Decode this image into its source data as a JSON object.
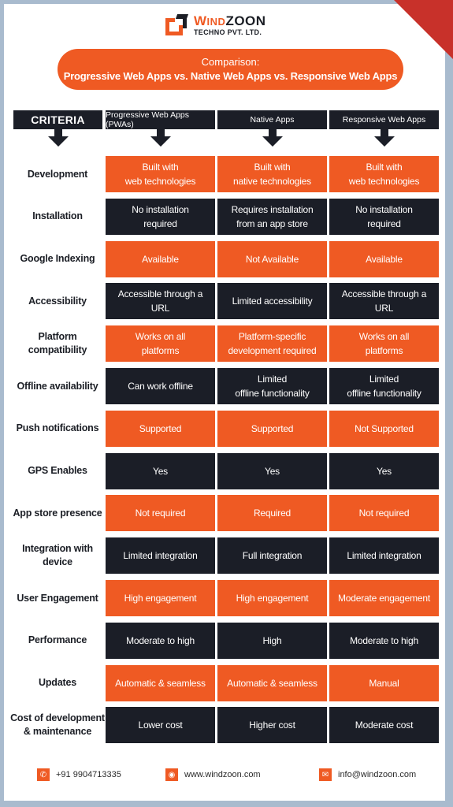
{
  "brand": {
    "name_first": "W",
    "name_ind": "IND",
    "name_rest": "ZOON",
    "subtitle": "TECHNO PVT. LTD."
  },
  "title": {
    "line1": "Comparison:",
    "line2": "Progressive Web Apps vs. Native Web Apps vs. Responsive Web Apps"
  },
  "colors": {
    "accent": "#ef5a23",
    "dark": "#1b1e27",
    "corner": "#c8312a",
    "frame": "#a9bbce"
  },
  "table": {
    "headers": [
      "CRITERIA",
      "Progressive Web Apps (PWAs)",
      "Native Apps",
      "Responsive Web Apps"
    ],
    "rows": [
      {
        "criteria": "Development",
        "style": "orange",
        "values": [
          "Built with\nweb technologies",
          "Built with\nnative technologies",
          "Built with\nweb technologies"
        ]
      },
      {
        "criteria": "Installation",
        "style": "dark",
        "values": [
          "No installation\nrequired",
          "Requires installation\nfrom an app store",
          "No installation\nrequired"
        ]
      },
      {
        "criteria": "Google Indexing",
        "style": "orange",
        "values": [
          "Available",
          "Not Available",
          "Available"
        ]
      },
      {
        "criteria": "Accessibility",
        "style": "dark",
        "values": [
          "Accessible through a\nURL",
          "Limited accessibility",
          "Accessible through a\nURL"
        ]
      },
      {
        "criteria": "Platform\ncompatibility",
        "style": "orange",
        "values": [
          "Works on all\nplatforms",
          "Platform-specific\ndevelopment required",
          "Works on all\nplatforms"
        ]
      },
      {
        "criteria": "Offline availability",
        "style": "dark",
        "values": [
          "Can work offline",
          "Limited\noffline functionality",
          "Limited\noffline functionality"
        ]
      },
      {
        "criteria": "Push notifications",
        "style": "orange",
        "values": [
          "Supported",
          "Supported",
          "Not Supported"
        ]
      },
      {
        "criteria": "GPS Enables",
        "style": "dark",
        "values": [
          "Yes",
          "Yes",
          "Yes"
        ]
      },
      {
        "criteria": "App store presence",
        "style": "orange",
        "values": [
          "Not required",
          "Required",
          "Not required"
        ]
      },
      {
        "criteria": "Integration with\ndevice",
        "style": "dark",
        "values": [
          "Limited integration",
          "Full integration",
          "Limited integration"
        ]
      },
      {
        "criteria": "User Engagement",
        "style": "orange",
        "values": [
          "High engagement",
          "High engagement",
          "Moderate engagement"
        ]
      },
      {
        "criteria": "Performance",
        "style": "dark",
        "values": [
          "Moderate to high",
          "High",
          "Moderate to high"
        ]
      },
      {
        "criteria": "Updates",
        "style": "orange",
        "values": [
          "Automatic & seamless",
          "Automatic & seamless",
          "Manual"
        ]
      },
      {
        "criteria": "Cost of development\n& maintenance",
        "style": "dark",
        "values": [
          "Lower cost",
          "Higher cost",
          "Moderate cost"
        ]
      }
    ]
  },
  "footer": {
    "phone": {
      "icon": "phone-icon",
      "text": "+91 9904713335"
    },
    "website": {
      "icon": "globe-icon",
      "text": "www.windzoon.com"
    },
    "email": {
      "icon": "mail-icon",
      "text": "info@windzoon.com"
    }
  }
}
